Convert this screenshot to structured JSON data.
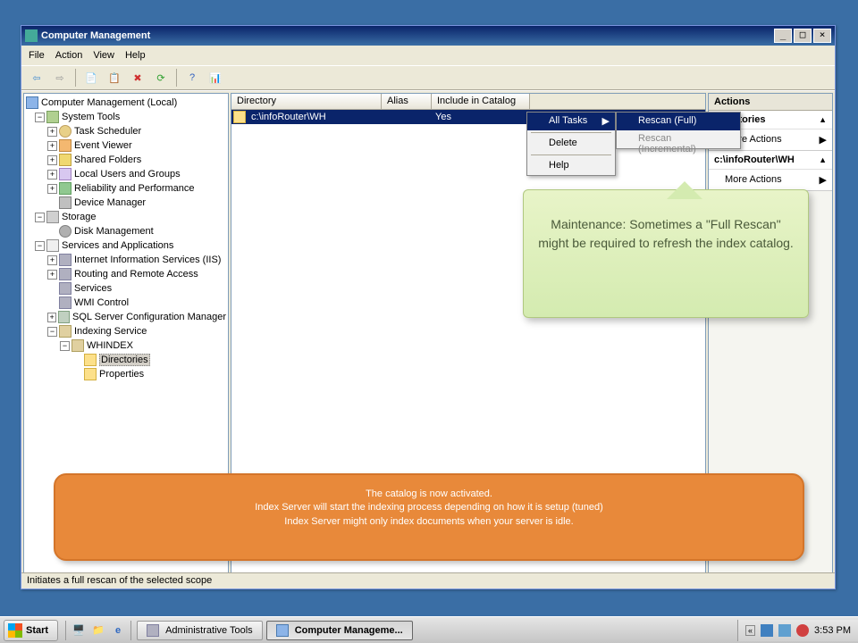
{
  "window": {
    "title": "Computer Management"
  },
  "menubar": [
    "File",
    "Action",
    "View",
    "Help"
  ],
  "tree": {
    "root": "Computer Management (Local)",
    "system_tools": "System Tools",
    "task_scheduler": "Task Scheduler",
    "event_viewer": "Event Viewer",
    "shared_folders": "Shared Folders",
    "local_users": "Local Users and Groups",
    "reliability": "Reliability and Performance",
    "device_manager": "Device Manager",
    "storage": "Storage",
    "disk_management": "Disk Management",
    "services_apps": "Services and Applications",
    "iis": "Internet Information Services (IIS)",
    "routing": "Routing and Remote Access",
    "services": "Services",
    "wmi": "WMI Control",
    "sqlserver": "SQL Server Configuration Manager",
    "indexing": "Indexing Service",
    "whindex": "WHINDEX",
    "directories": "Directories",
    "properties": "Properties"
  },
  "list": {
    "headers": [
      "Directory",
      "Alias",
      "Include in Catalog"
    ],
    "rows": [
      {
        "directory": "c:\\infoRouter\\WH",
        "alias": "",
        "include": "Yes"
      }
    ]
  },
  "context_menu": {
    "all_tasks": "All Tasks",
    "delete": "Delete",
    "help": "Help",
    "rescan_full": "Rescan (Full)",
    "rescan_incremental": "Rescan (Incremental)"
  },
  "actions_pane": {
    "header": "Actions",
    "section1_title": "Directories",
    "section2_title": "c:\\infoRouter\\WH",
    "more_actions": "More Actions"
  },
  "callout_green": "Maintenance: Sometimes a \"Full Rescan\" might be required to refresh the index catalog.",
  "callout_orange_line1": "The catalog is now activated.",
  "callout_orange_line2": "Index Server will start the indexing process depending on how it is setup (tuned)",
  "callout_orange_line3": "Index Server might only index documents when your server is idle.",
  "statusbar": "Initiates a full rescan of the selected scope",
  "taskbar": {
    "start": "Start",
    "task1": "Administrative Tools",
    "task2": "Computer Manageme...",
    "clock": "3:53 PM"
  }
}
